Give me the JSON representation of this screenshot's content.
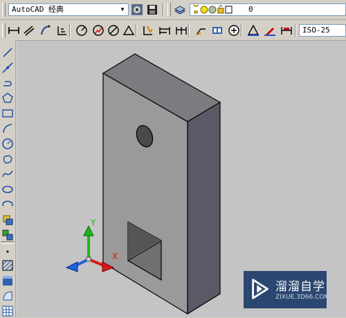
{
  "workspace": {
    "selected": "AutoCAD 经典"
  },
  "layer": {
    "name": "0"
  },
  "dimstyle": {
    "selected": "ISO-25"
  },
  "ucs": {
    "x_label": "X",
    "y_label": "Y"
  },
  "watermark": {
    "brand": "溜溜自学",
    "url": "ZIXUE.3D66.COM"
  },
  "colors": {
    "toolbar_bg": "#d4d0c8",
    "viewport_bg": "#c4c4c4",
    "axis_x": "#d81818",
    "axis_y": "#18b818",
    "axis_z": "#2060e0"
  },
  "toolbar_icons": [
    "linear-dim-icon",
    "aligned-dim-icon",
    "arc-length-dim-icon",
    "ordinate-dim-icon",
    "radius-dim-icon",
    "jogged-dim-icon",
    "diameter-dim-icon",
    "angular-dim-icon",
    "quick-dim-icon",
    "baseline-dim-icon",
    "continue-dim-icon",
    "quick-leader-icon",
    "tolerance-icon",
    "center-mark-icon",
    "dim-edit-icon",
    "dim-text-edit-icon",
    "dim-update-icon"
  ],
  "draw_tools": [
    "line-icon",
    "construction-line-icon",
    "polyline-icon",
    "polygon-icon",
    "rectangle-icon",
    "arc-icon",
    "circle-icon",
    "revcloud-icon",
    "spline-icon",
    "ellipse-icon",
    "ellipse-arc-icon",
    "insert-block-icon",
    "make-block-icon",
    "point-icon",
    "hatch-icon",
    "gradient-icon",
    "region-icon",
    "table-icon"
  ]
}
